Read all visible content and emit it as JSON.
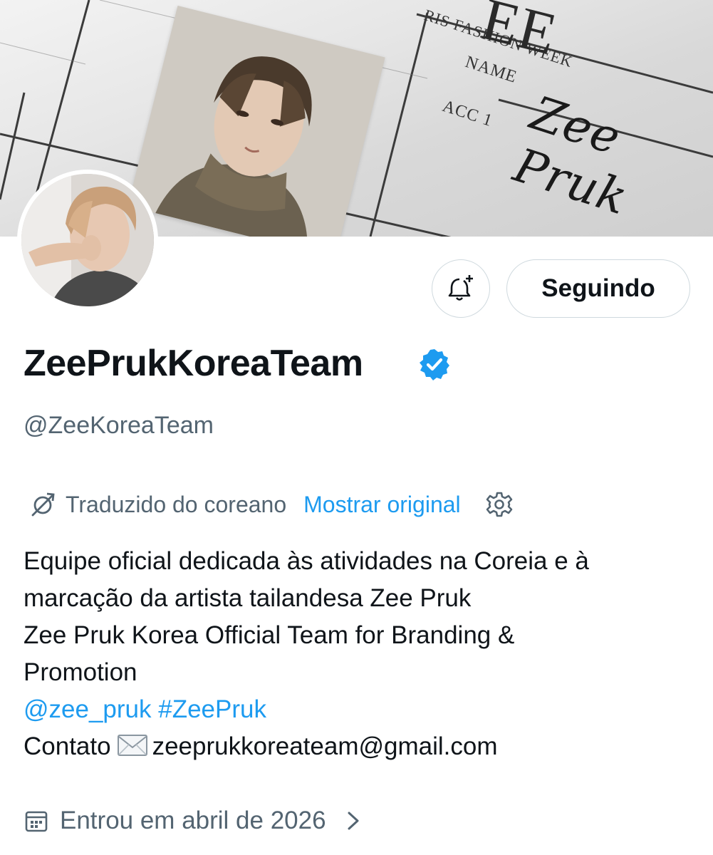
{
  "banner": {
    "title_text": "EE",
    "subtitle_text": "RIS FASHION WEEK",
    "name_label": "NAME",
    "acc_label": "ACC 1",
    "signature": "Zee Pruk"
  },
  "profile": {
    "display_name": "ZeePrukKoreaTeam",
    "handle": "@ZeeKoreaTeam",
    "verified": true,
    "verified_color": "#1d9bf0"
  },
  "actions": {
    "notify_icon": "bell-plus-icon",
    "follow_label": "Seguindo"
  },
  "translation": {
    "label": "Traduzido do coreano",
    "show_original": "Mostrar original",
    "settings_icon": "gear-icon"
  },
  "bio": {
    "line1": "Equipe oficial dedicada às atividades na Coreia e à",
    "line2": "marcação da artista tailandesa Zee Pruk",
    "line3": "Zee Pruk Korea Official Team for Branding &",
    "line4": "Promotion",
    "mention": "@zee_pruk",
    "hashtag": "#ZeePruk",
    "contact_label": "Contato",
    "contact_icon": "envelope-icon",
    "email": "zeeprukkoreateam@gmail.com"
  },
  "joined": {
    "text": "Entrou em abril de 2026",
    "icon": "calendar-icon"
  },
  "colors": {
    "text_primary": "#0f1419",
    "text_secondary": "#536471",
    "link": "#1d9bf0",
    "border": "#cfd9de"
  }
}
